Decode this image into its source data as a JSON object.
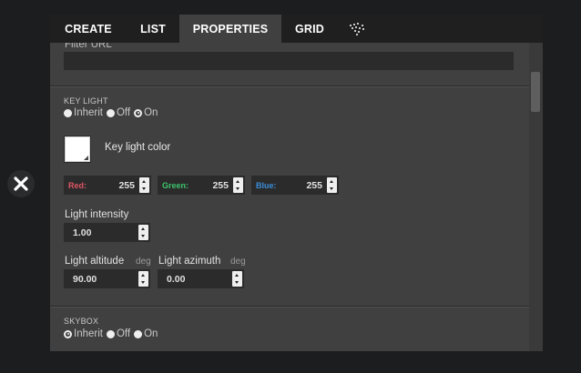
{
  "tabs": [
    {
      "label": "CREATE"
    },
    {
      "label": "LIST"
    },
    {
      "label": "PROPERTIES",
      "active": true
    },
    {
      "label": "GRID"
    }
  ],
  "tab_icon": "particle-dots-icon",
  "filter_url": {
    "label": "Filter URL",
    "value": ""
  },
  "key_light": {
    "section_title": "KEY LIGHT",
    "mode_options": [
      {
        "label": "Inherit",
        "selected": false
      },
      {
        "label": "Off",
        "selected": false
      },
      {
        "label": "On",
        "selected": true
      }
    ],
    "color_label": "Key light color",
    "color_swatch": "#ffffff",
    "red": {
      "label": "Red:",
      "value": "255",
      "color": "#e05565"
    },
    "green": {
      "label": "Green:",
      "value": "255",
      "color": "#3ec46d"
    },
    "blue": {
      "label": "Blue:",
      "value": "255",
      "color": "#3a8ed8"
    },
    "intensity": {
      "label": "Light intensity",
      "value": "1.00"
    },
    "altitude": {
      "label": "Light altitude",
      "unit": "deg",
      "value": "90.00"
    },
    "azimuth": {
      "label": "Light azimuth",
      "unit": "deg",
      "value": "0.00"
    }
  },
  "skybox": {
    "section_title": "SKYBOX",
    "mode_options": [
      {
        "label": "Inherit",
        "selected": true
      },
      {
        "label": "Off",
        "selected": false
      },
      {
        "label": "On",
        "selected": false
      }
    ]
  },
  "close_icon": "close-icon"
}
